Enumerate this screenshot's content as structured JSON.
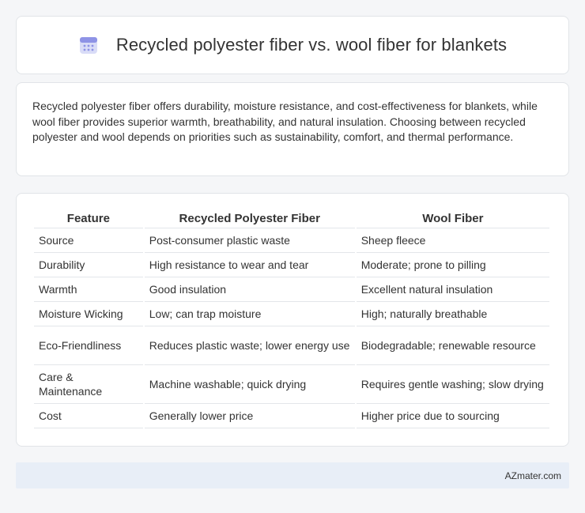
{
  "header": {
    "icon": "calendar-icon",
    "title": "Recycled polyester fiber vs. wool fiber for blankets"
  },
  "summary": {
    "text": "Recycled polyester fiber offers durability, moisture resistance, and cost-effectiveness for blankets, while wool fiber provides superior warmth, breathability, and natural insulation. Choosing between recycled polyester and wool depends on priorities such as sustainability, comfort, and thermal performance."
  },
  "table": {
    "headers": [
      "Feature",
      "Recycled Polyester Fiber",
      "Wool Fiber"
    ],
    "rows": [
      [
        "Source",
        "Post-consumer plastic waste",
        "Sheep fleece"
      ],
      [
        "Durability",
        "High resistance to wear and tear",
        "Moderate; prone to pilling"
      ],
      [
        "Warmth",
        "Good insulation",
        "Excellent natural insulation"
      ],
      [
        "Moisture Wicking",
        "Low; can trap moisture",
        "High; naturally breathable"
      ],
      [
        "Eco-Friendliness",
        "Reduces plastic waste; lower energy use",
        "Biodegradable; renewable resource"
      ],
      [
        "Care & Maintenance",
        "Machine washable; quick drying",
        "Requires gentle washing; slow drying"
      ],
      [
        "Cost",
        "Generally lower price",
        "Higher price due to sourcing"
      ]
    ]
  },
  "footer": {
    "text": "AZmater.com"
  },
  "colors": {
    "background": "#f5f6f8",
    "card": "#ffffff",
    "footer_bg": "#e8eef7",
    "icon_accent": "#7b7fd6"
  }
}
